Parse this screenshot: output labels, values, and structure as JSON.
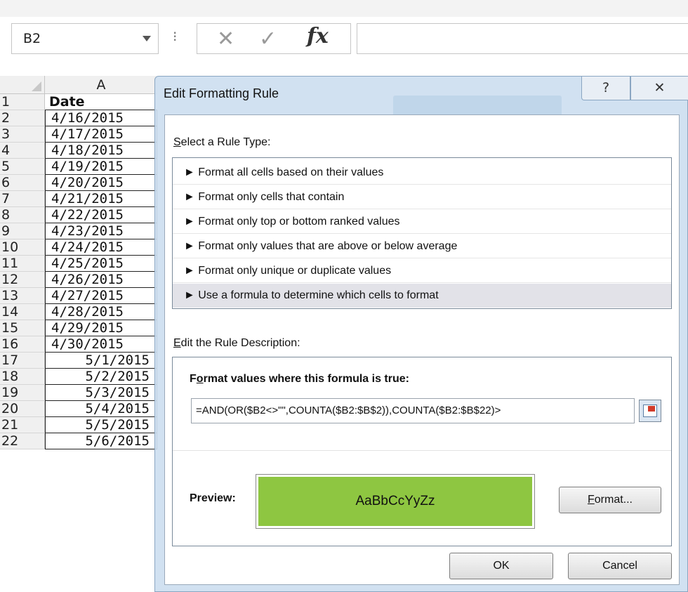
{
  "formula_bar": {
    "name_box": "B2",
    "separator": "⁝",
    "cancel_glyph": "✕",
    "enter_glyph": "✓",
    "fx_label": "fx",
    "formula": ""
  },
  "sheet": {
    "column_header": "A",
    "header_row": {
      "num": "1",
      "value": "Date"
    },
    "rows": [
      {
        "num": "2",
        "value": "4/16/2015"
      },
      {
        "num": "3",
        "value": "4/17/2015"
      },
      {
        "num": "4",
        "value": "4/18/2015"
      },
      {
        "num": "5",
        "value": "4/19/2015"
      },
      {
        "num": "6",
        "value": "4/20/2015"
      },
      {
        "num": "7",
        "value": "4/21/2015"
      },
      {
        "num": "8",
        "value": "4/22/2015"
      },
      {
        "num": "9",
        "value": "4/23/2015"
      },
      {
        "num": "10",
        "value": "4/24/2015"
      },
      {
        "num": "11",
        "value": "4/25/2015"
      },
      {
        "num": "12",
        "value": "4/26/2015"
      },
      {
        "num": "13",
        "value": "4/27/2015"
      },
      {
        "num": "14",
        "value": "4/28/2015"
      },
      {
        "num": "15",
        "value": "4/29/2015"
      },
      {
        "num": "16",
        "value": "4/30/2015"
      },
      {
        "num": "17",
        "value": "5/1/2015"
      },
      {
        "num": "18",
        "value": "5/2/2015"
      },
      {
        "num": "19",
        "value": "5/3/2015"
      },
      {
        "num": "20",
        "value": "5/4/2015"
      },
      {
        "num": "21",
        "value": "5/5/2015"
      },
      {
        "num": "22",
        "value": "5/6/2015"
      }
    ]
  },
  "dialog": {
    "title": "Edit Formatting Rule",
    "help_glyph": "?",
    "close_glyph": "✕",
    "rule_type_label_accel": "S",
    "rule_type_label_rest": "elect a Rule Type:",
    "rule_types": [
      "► Format all cells based on their values",
      "► Format only cells that contain",
      "► Format only top or bottom ranked values",
      "► Format only values that are above or below average",
      "► Format only unique or duplicate values",
      "► Use a formula to determine which cells to format"
    ],
    "selected_rule_index": 5,
    "description_label_accel": "E",
    "description_label_rest": "dit the Rule Description:",
    "formula_label_pre": "F",
    "formula_label_accel": "o",
    "formula_label_rest": "rmat values where this formula is true:",
    "formula_value": "=AND(OR($B2<>\"\",COUNTA($B2:$B$2)),COUNTA($B2:$B$22)>",
    "preview_label": "Preview:",
    "preview_text": "AaBbCcYyZz",
    "preview_color": "#8ec641",
    "format_button_accel": "F",
    "format_button_rest": "ormat...",
    "ok_button": "OK",
    "cancel_button": "Cancel"
  }
}
